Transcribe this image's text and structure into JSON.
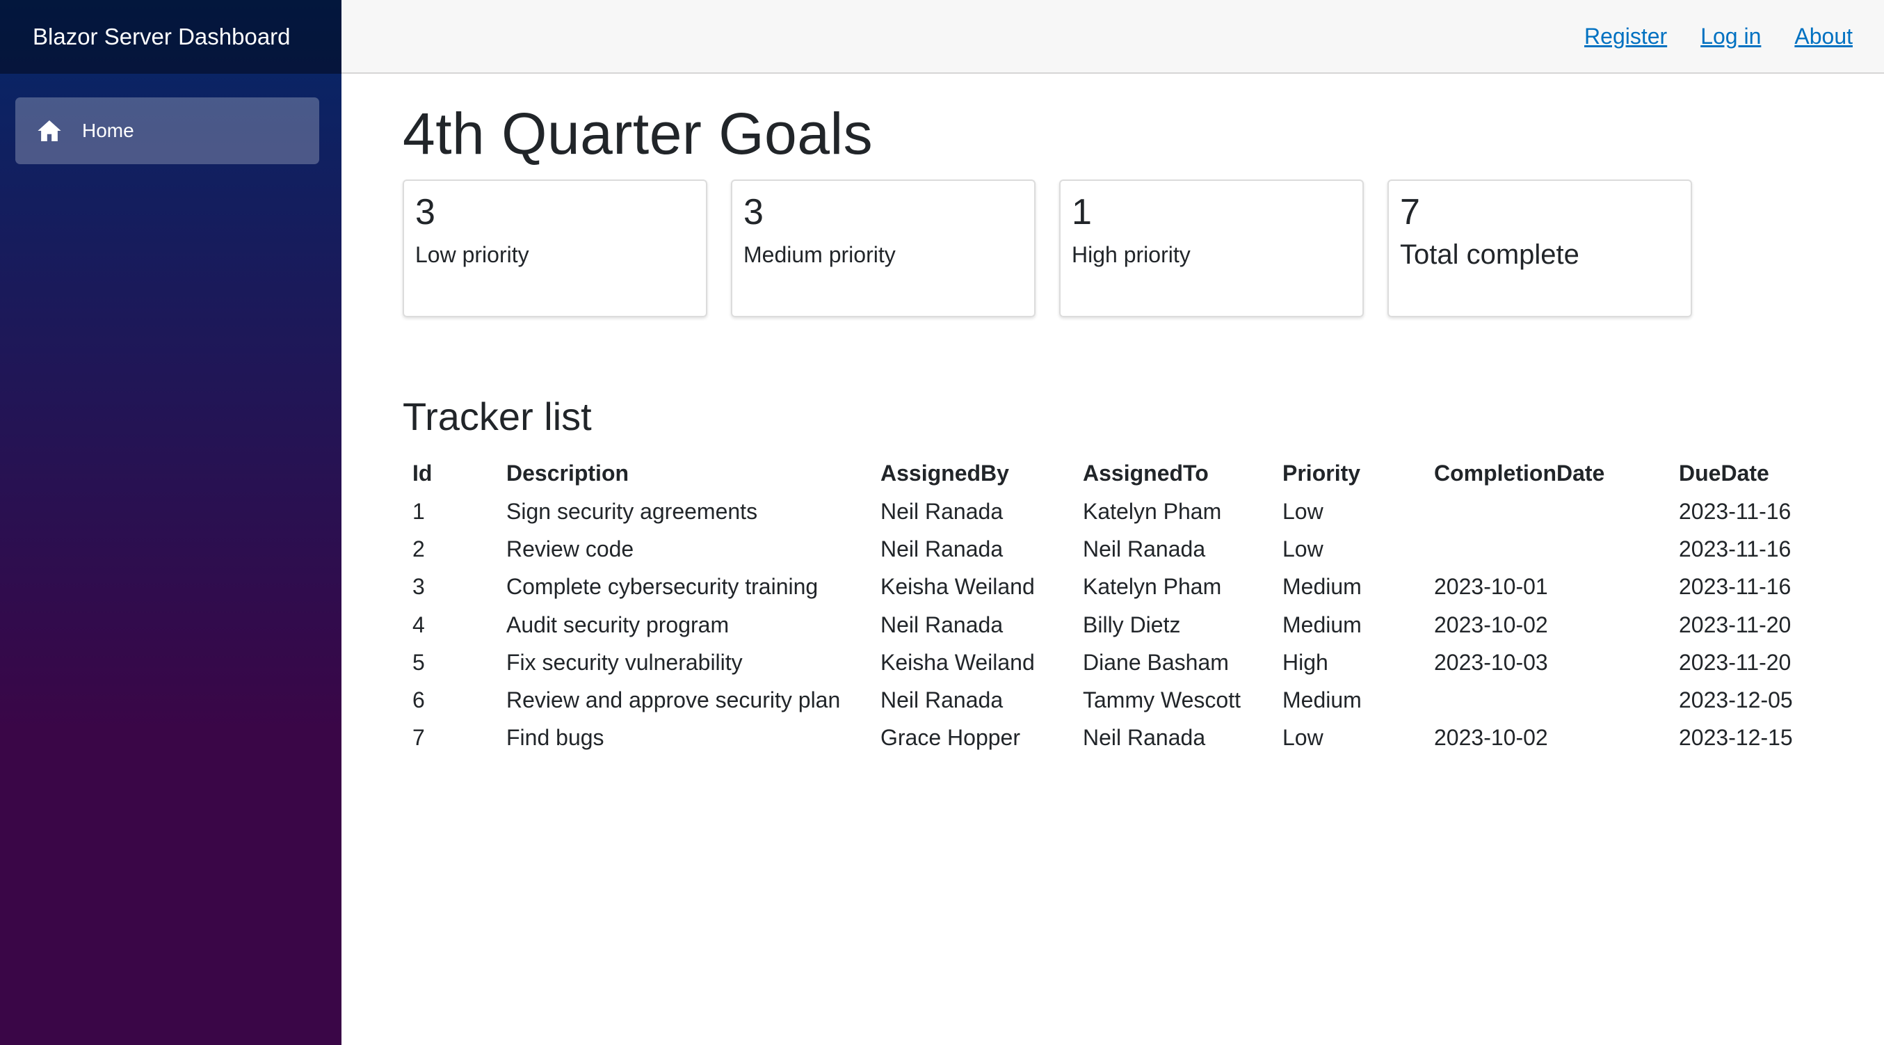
{
  "sidebar": {
    "brand": "Blazor Server Dashboard",
    "nav_items": [
      {
        "label": "Home",
        "icon": "home-icon"
      }
    ]
  },
  "top_row": {
    "links": [
      "Register",
      "Log in",
      "About"
    ]
  },
  "page": {
    "title": "4th Quarter Goals"
  },
  "cards": [
    {
      "count": "3",
      "label": "Low priority"
    },
    {
      "count": "3",
      "label": "Medium priority"
    },
    {
      "count": "1",
      "label": "High priority"
    },
    {
      "count": "7",
      "label": "Total complete"
    }
  ],
  "tracker": {
    "title": "Tracker list",
    "columns": [
      "Id",
      "Description",
      "AssignedBy",
      "AssignedTo",
      "Priority",
      "CompletionDate",
      "DueDate"
    ],
    "rows": [
      [
        "1",
        "Sign security agreements",
        "Neil Ranada",
        "Katelyn Pham",
        "Low",
        "",
        "2023-11-16"
      ],
      [
        "2",
        "Review code",
        "Neil Ranada",
        "Neil Ranada",
        "Low",
        "",
        "2023-11-16"
      ],
      [
        "3",
        "Complete cybersecurity training",
        "Keisha Weiland",
        "Katelyn Pham",
        "Medium",
        "2023-10-01",
        "2023-11-16"
      ],
      [
        "4",
        "Audit security program",
        "Neil Ranada",
        "Billy Dietz",
        "Medium",
        "2023-10-02",
        "2023-11-20"
      ],
      [
        "5",
        "Fix security vulnerability",
        "Keisha Weiland",
        "Diane Basham",
        "High",
        "2023-10-03",
        "2023-11-20"
      ],
      [
        "6",
        "Review and approve security plan",
        "Neil Ranada",
        "Tammy Wescott",
        "Medium",
        "",
        "2023-12-05"
      ],
      [
        "7",
        "Find bugs",
        "Grace Hopper",
        "Neil Ranada",
        "Low",
        "2023-10-02",
        "2023-12-15"
      ]
    ]
  },
  "colors": {
    "sidebar_top": "#052767",
    "sidebar_bottom": "#3a0647",
    "link": "#0071c1",
    "top_row_bg": "#f7f7f7"
  }
}
